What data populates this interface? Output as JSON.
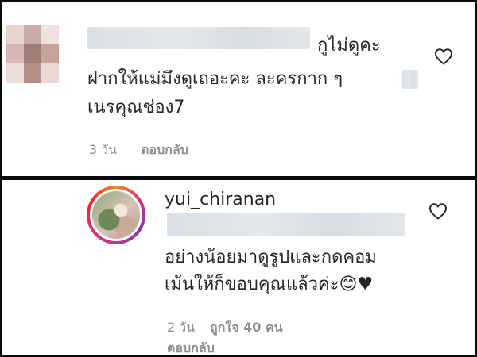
{
  "comment1": {
    "text_line1": "กูไม่ดูคะ",
    "text_line2": "ฝากให้แม่มึงดูเถอะคะ ละครกาก ๆ",
    "text_line3": "เนรคุณช่อง7",
    "time": "3 วัน",
    "reply_label": "ตอบกลับ"
  },
  "comment2": {
    "username": "yui_chiranan",
    "text_line1": "อย่างน้อยมาดูรูปและกดคอม",
    "text_line2": "เม้นให้ก็ขอบคุณแล้วค่ะ",
    "emoji": "😊♥",
    "time": "2 วัน",
    "likes": "ถูกใจ 40 คน",
    "reply_label": "ตอบกลับ"
  },
  "icons": [
    "heart-outline-icon",
    "heart-outline-icon"
  ],
  "colors": {
    "text": "#262626",
    "meta": "#8e8e8e",
    "background": "#ffffff",
    "border": "#0a0a0a"
  }
}
